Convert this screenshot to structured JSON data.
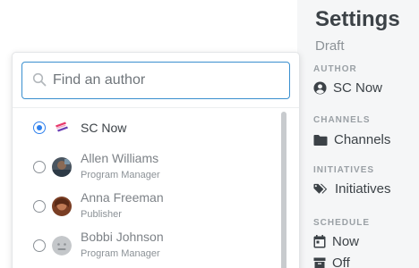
{
  "settings": {
    "title": "Settings",
    "status": "Draft",
    "sections": {
      "author": {
        "label": "AUTHOR",
        "value": "SC Now"
      },
      "channels": {
        "label": "CHANNELS",
        "value": "Channels"
      },
      "initiatives": {
        "label": "INITIATIVES",
        "value": "Initiatives"
      },
      "schedule": {
        "label": "SCHEDULE",
        "now": "Now",
        "off": "Off"
      }
    }
  },
  "author_picker": {
    "search": {
      "placeholder": "Find an author",
      "value": ""
    },
    "options": [
      {
        "name": "SC Now",
        "role": "",
        "selected": true,
        "avatar": "sc-now-logo"
      },
      {
        "name": "Allen Williams",
        "role": "Program Manager",
        "selected": false,
        "avatar": "photo"
      },
      {
        "name": "Anna Freeman",
        "role": "Publisher",
        "selected": false,
        "avatar": "photo"
      },
      {
        "name": "Bobbi Johnson",
        "role": "Program Manager",
        "selected": false,
        "avatar": "default-avatar"
      }
    ]
  },
  "colors": {
    "accent": "#2f80ed",
    "focus_border": "#3a8fcf",
    "panel_bg": "#f5f6f7"
  }
}
